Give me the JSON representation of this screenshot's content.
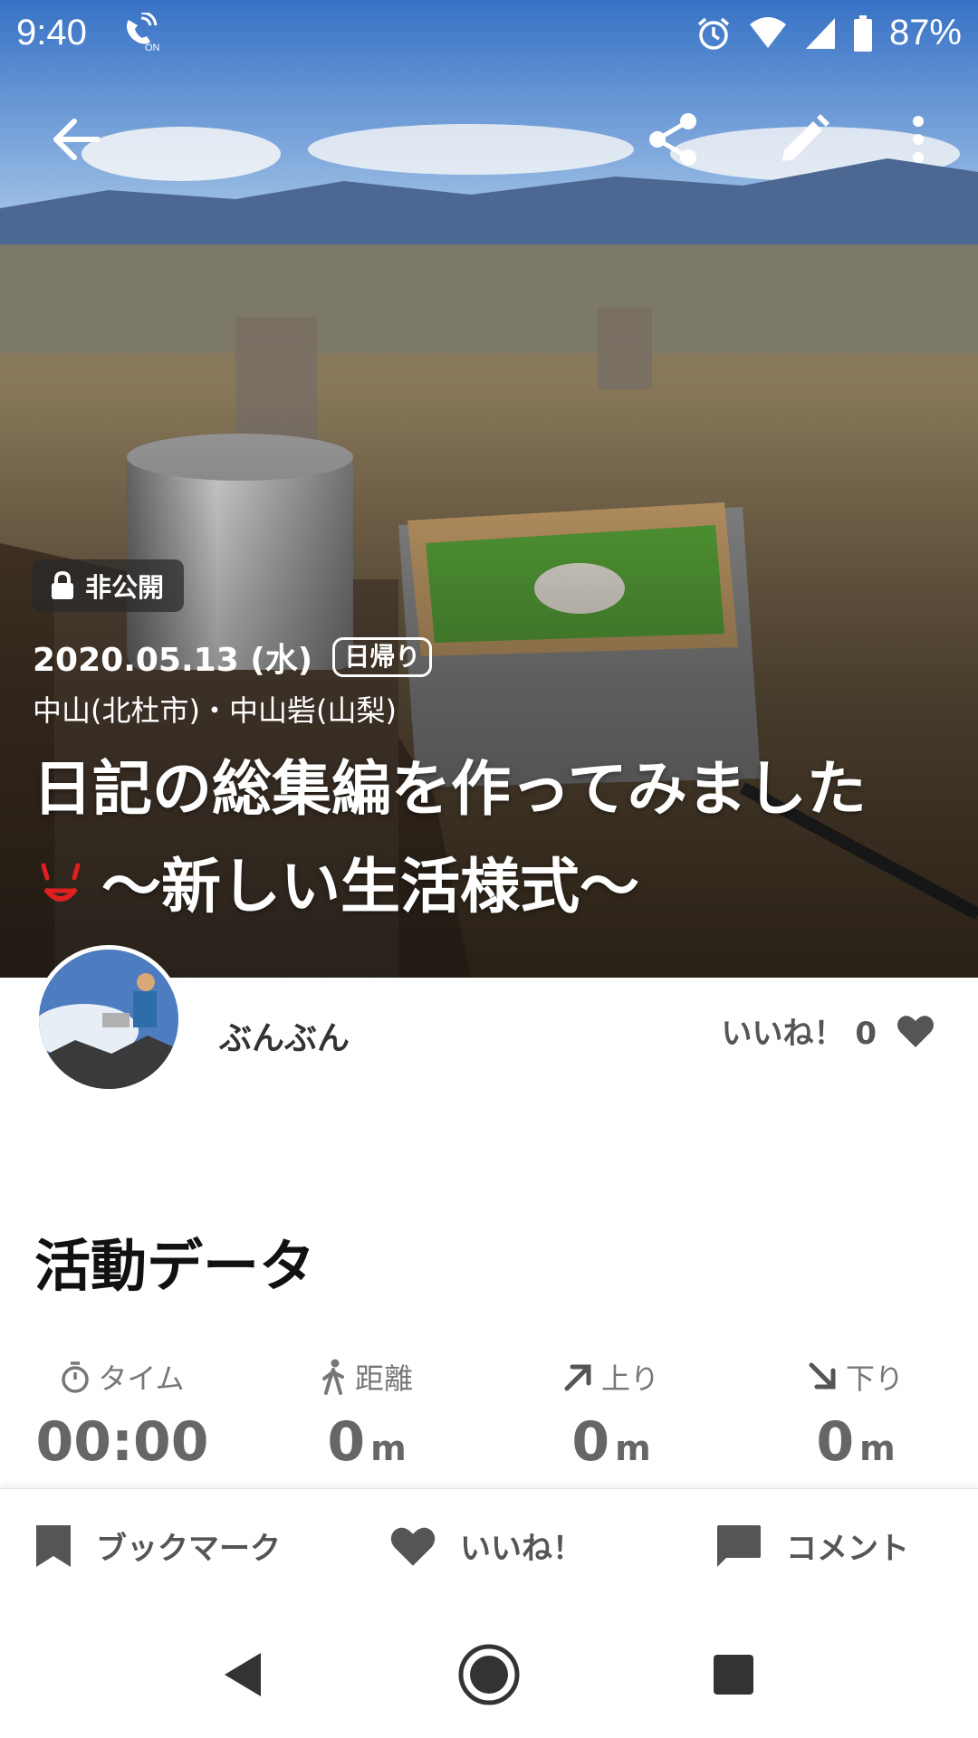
{
  "status_bar": {
    "time": "9:40",
    "call_icon": "wifi-calling-icon",
    "alarm_icon": "alarm-icon",
    "wifi_icon": "wifi-icon",
    "signal_icon": "cellular-signal-icon",
    "battery_icon": "battery-icon",
    "battery_percent": "87%"
  },
  "toolbar": {
    "back_icon": "arrow-back-icon",
    "share_icon": "share-icon",
    "edit_icon": "pencil-icon",
    "more_icon": "more-vertical-icon"
  },
  "hero": {
    "private_label": "非公開",
    "date": "2020.05.13 (水)",
    "trip_type": "日帰り",
    "location": "中山(北杜市)・中山砦(山梨)",
    "title_line1": "日記の総集編を作ってみました",
    "title_line2": "〜新しい生活様式〜"
  },
  "user": {
    "name": "ぶんぶん",
    "like_label": "いいね！",
    "like_count": "0"
  },
  "activity": {
    "heading": "活動データ",
    "stats": [
      {
        "label": "タイム",
        "icon": "stopwatch-icon",
        "value": "00:00",
        "unit": ""
      },
      {
        "label": "距離",
        "icon": "hiker-icon",
        "value": "0",
        "unit": "m"
      },
      {
        "label": "上り",
        "icon": "arrow-up-right-icon",
        "value": "0",
        "unit": "m"
      },
      {
        "label": "下り",
        "icon": "arrow-down-right-icon",
        "value": "0",
        "unit": "m"
      }
    ]
  },
  "bottom_bar": {
    "bookmark_label": "ブックマーク",
    "like_label": "いいね！",
    "comment_label": "コメント"
  },
  "colors": {
    "accent_red": "#e02020",
    "icon_gray": "#555555"
  }
}
